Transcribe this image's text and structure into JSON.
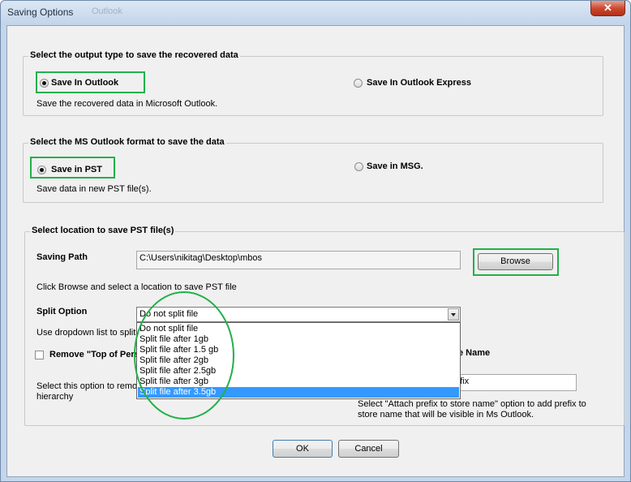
{
  "window": {
    "title": "Saving Options",
    "ghost_title": "Outlook",
    "close_label": "✕"
  },
  "output_group": {
    "legend": "Select the output type to save the recovered data",
    "option_outlook": "Save In Outlook",
    "option_express": "Save In Outlook Express",
    "description": "Save the recovered data in Microsoft Outlook.",
    "selected": "Save In Outlook"
  },
  "format_group": {
    "legend": "Select the MS Outlook format to save the data",
    "option_pst": "Save in PST",
    "option_msg": "Save in MSG.",
    "description": "Save data in new PST file(s).",
    "selected": "Save in PST"
  },
  "location_group": {
    "legend": "Select location to save PST file(s)",
    "saving_path_label": "Saving Path",
    "saving_path_value": "C:\\Users\\nikitag\\Desktop\\mbos",
    "browse_label": "Browse",
    "browse_hint": "Click Browse and select a location to save PST file",
    "split_label": "Split Option",
    "split_selected": "Do not split file",
    "split_hint": "Use dropdown list to split t",
    "split_options": [
      "Do not split file",
      "Split file after 1gb",
      "Split file after 1.5 gb",
      "Split file after 2gb",
      "Split file after 2.5gb",
      "Split file after 3gb",
      "Split file after 3.5gb"
    ],
    "highlighted_option": "Split file after 3.5gb",
    "remove_label": "Remove \"Top of Pers",
    "remove_hint_line1": "Select this option to remov",
    "remove_hint_line2": "hierarchy",
    "attach_label_tail": "e Name",
    "prefix_value_tail": "efix",
    "attach_hint_line1": "Select \"Attach prefix to store name\" option to add prefix to",
    "attach_hint_line2": "store name that will be visible in Ms Outlook."
  },
  "footer": {
    "ok_label": "OK",
    "cancel_label": "Cancel"
  },
  "colors": {
    "highlight_green": "#22b04a",
    "selection_blue": "#3399ff"
  }
}
